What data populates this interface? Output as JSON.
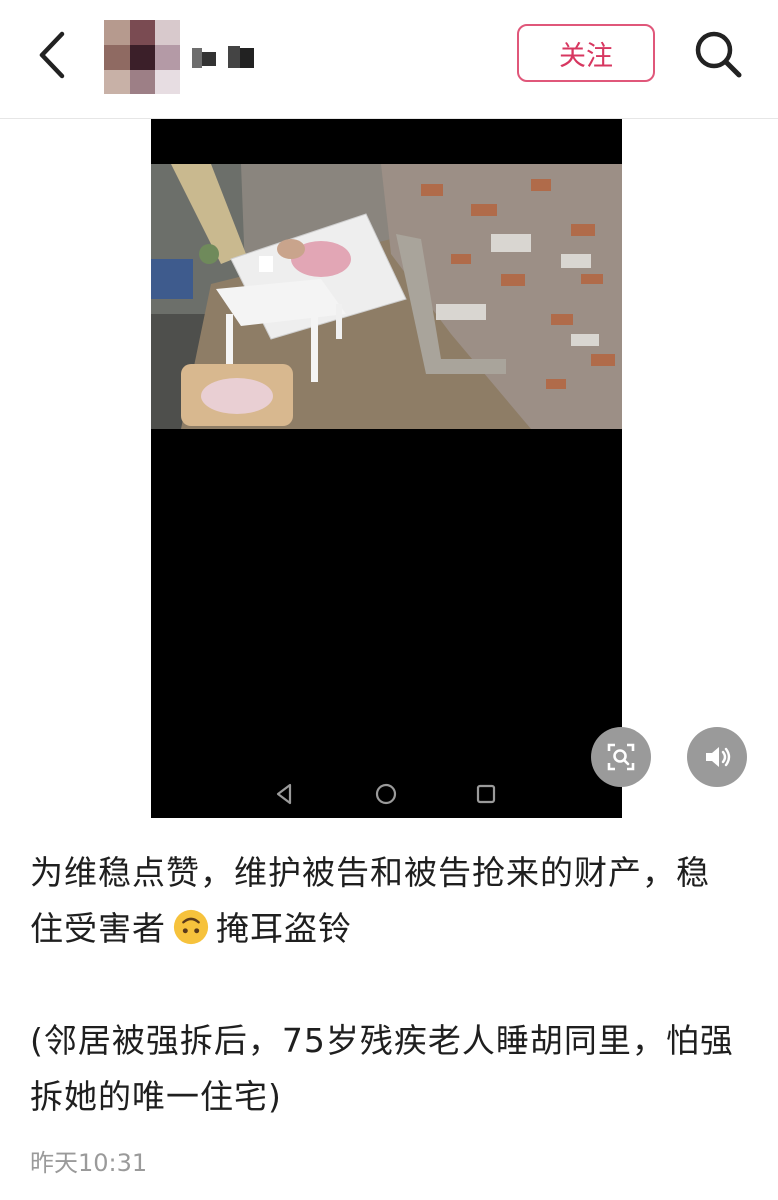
{
  "header": {
    "back_icon": "chevron-left-icon",
    "follow_label": "关注",
    "search_icon": "search-icon",
    "accent_color": "#e0577a"
  },
  "video": {
    "nav_icons": [
      "back-triangle-icon",
      "home-circle-icon",
      "recents-square-icon"
    ],
    "scan_icon": "image-search-icon",
    "volume_icon": "volume-icon"
  },
  "post": {
    "line1": "为维稳点赞，维护被告和被告抢来的财产，稳",
    "line2a": "住受害者",
    "line2b": "掩耳盗铃",
    "line3": "(邻居被强拆后，75岁残疾老人睡胡同里，怕强",
    "line4": "拆她的唯一住宅)",
    "emoji": "upside-down-face-emoji",
    "time": "昨天10:31"
  }
}
